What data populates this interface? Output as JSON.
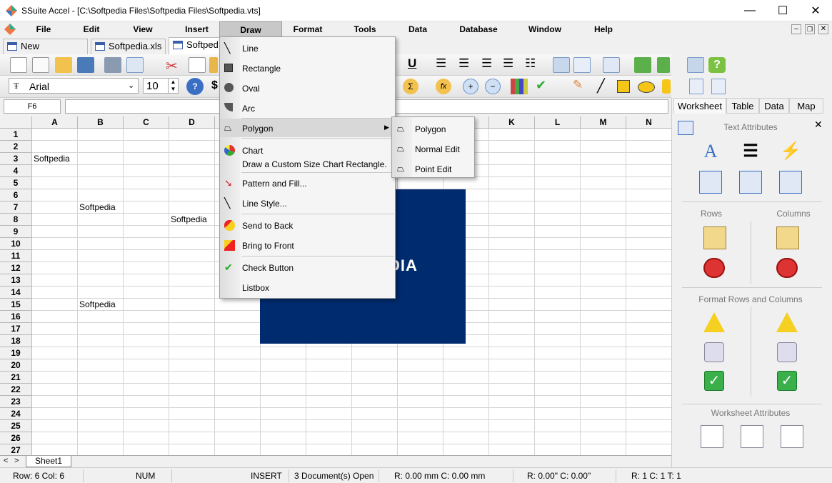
{
  "app": {
    "title": "SSuite Accel - [C:\\Softpedia Files\\Softpedia Files\\Softpedia.vts]"
  },
  "window_controls": {
    "minimize": "—",
    "maximize": "☐",
    "close": "✕"
  },
  "menubar": [
    "File",
    "Edit",
    "View",
    "Insert",
    "Draw",
    "Format",
    "Tools",
    "Data",
    "Database",
    "Window",
    "Help"
  ],
  "doc_tabs": [
    "New Workbook",
    "Softpedia.xls",
    "Softped"
  ],
  "font": {
    "name": "Arial",
    "size": "10"
  },
  "cell_ref": "F6",
  "columns": [
    "A",
    "B",
    "C",
    "D",
    "E",
    "F",
    "G",
    "H",
    "I",
    "J",
    "K",
    "L",
    "M",
    "N"
  ],
  "rows": [
    "1",
    "2",
    "3",
    "4",
    "5",
    "6",
    "7",
    "8",
    "9",
    "10",
    "11",
    "12",
    "13",
    "14",
    "15",
    "16",
    "17",
    "18",
    "19",
    "20",
    "21",
    "22",
    "23",
    "24",
    "25",
    "26",
    "27"
  ],
  "cells": {
    "A3": "Softpedia",
    "B7": "Softpedia",
    "D8": "Softpedia",
    "B15": "Softpedia"
  },
  "image_text": "DIA",
  "sheet_tab": "Sheet1",
  "draw_menu": {
    "items": [
      "Line",
      "Rectangle",
      "Oval",
      "Arc",
      "Polygon",
      "Chart",
      "Pattern and Fill...",
      "Line Style...",
      "Send to Back",
      "Bring to Front",
      "Check Button",
      "Listbox"
    ],
    "chart_hint": "Draw a Custom Size Chart Rectangle."
  },
  "polygon_submenu": [
    "Polygon",
    "Normal Edit",
    "Point Edit"
  ],
  "panel": {
    "tabs": [
      "Worksheet",
      "Table",
      "Data",
      "Map"
    ],
    "text_attributes": "Text Attributes",
    "rows": "Rows",
    "columns": "Columns",
    "format_rows_cols": "Format Rows and Columns",
    "worksheet_attributes": "Worksheet Attributes",
    "close": "✕"
  },
  "status": {
    "row_col": "Row:  6  Col:  6",
    "num": "NUM",
    "insert": "INSERT",
    "docs": "3 Document(s) Open",
    "pos": "R: 0.00 mm   C: 0.00 mm",
    "inch": "R: 0.00\"  C: 0.00\"",
    "sel": "R: 1  C: 1  T: 1"
  },
  "colors": {
    "image_bg": "#002b6e",
    "accent": "#3a5fa8"
  }
}
